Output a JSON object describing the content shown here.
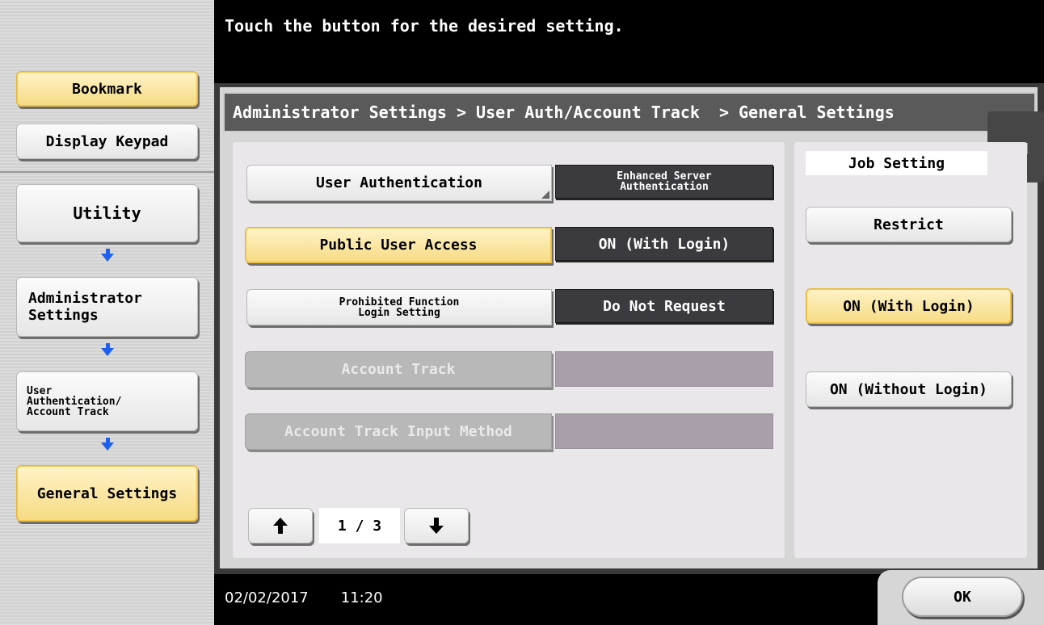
{
  "message": "Touch the button for the desired setting.",
  "left_nav": {
    "bookmark": "Bookmark",
    "display_keypad": "Display Keypad",
    "utility": "Utility",
    "administrator_settings": "Administrator\nSettings",
    "user_auth_account_track": "User\nAuthentication/\nAccount Track",
    "general_settings": "General Settings"
  },
  "breadcrumb": "Administrator Settings > User Auth/Account Track  > General Settings",
  "settings": [
    {
      "label": "User Authentication",
      "value": "Enhanced Server\nAuthentication"
    },
    {
      "label": "Public User Access",
      "value": "ON (With Login)"
    },
    {
      "label": "Prohibited Function\nLogin Setting",
      "value": "Do Not Request"
    },
    {
      "label": "Account Track",
      "value": ""
    },
    {
      "label": "Account Track Input Method",
      "value": ""
    }
  ],
  "pager": {
    "page": "1 / 3"
  },
  "job_setting": {
    "title": "Job Setting",
    "options": [
      "Restrict",
      "ON (With Login)",
      "ON (Without Login)"
    ]
  },
  "status": {
    "date": "02/02/2017",
    "time": "11:20"
  },
  "ok_label": "OK",
  "colors": {
    "highlight": "#f6db83",
    "value_box": "#3b3a3e",
    "arrow": "#1d5ff0"
  }
}
